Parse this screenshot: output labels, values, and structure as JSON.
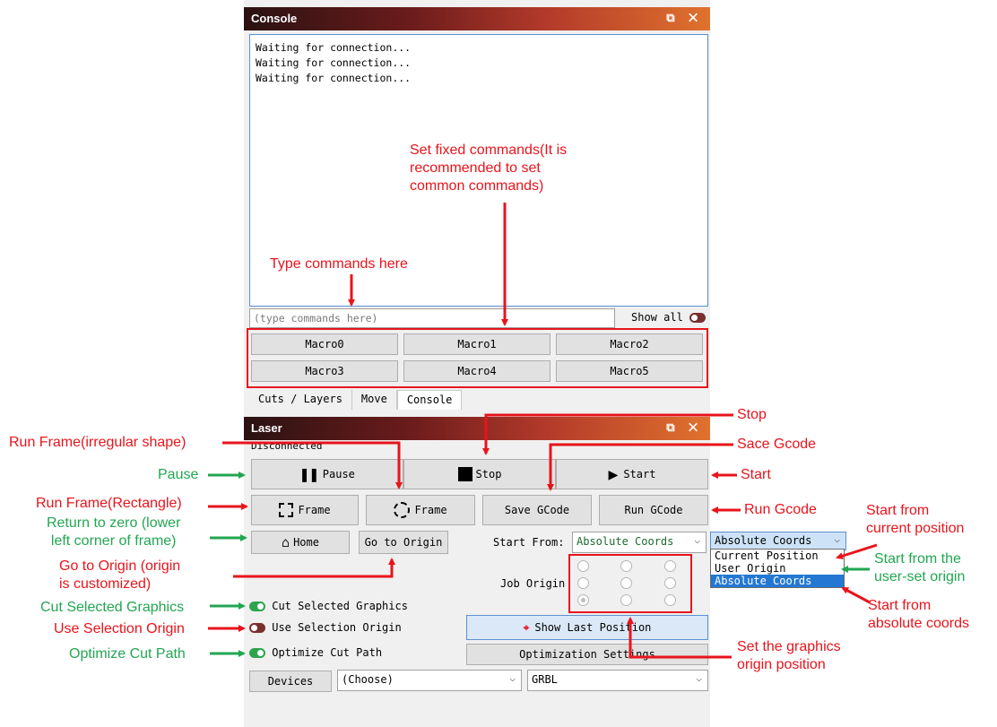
{
  "console": {
    "title": "Console",
    "controls": "⧉ ✕",
    "lines": [
      "Waiting for connection...",
      "Waiting for connection...",
      "Waiting for connection..."
    ],
    "input_placeholder": "(type commands here)",
    "show_all_label": "Show all",
    "macros": [
      "Macro0",
      "Macro1",
      "Macro2",
      "Macro3",
      "Macro4",
      "Macro5"
    ],
    "tabs": [
      "Cuts / Layers",
      "Move",
      "Console"
    ]
  },
  "laser": {
    "title": "Laser",
    "controls": "⧉ ✕",
    "status": "Disconnected",
    "pause": "Pause",
    "stop": "Stop",
    "start": "Start",
    "frame_rect": "Frame",
    "frame_irregular": "Frame",
    "save_gcode": "Save GCode",
    "run_gcode": "Run GCode",
    "home": "Home",
    "go_to_origin": "Go to Origin",
    "start_from_label": "Start From:",
    "start_from_value": "Absolute Coords",
    "start_from_value2": "Absolute Coords",
    "dropdown_options": [
      "Current Position",
      "User Origin",
      "Absolute Coords"
    ],
    "job_origin_label": "Job Origin",
    "cut_selected": "Cut Selected Graphics",
    "use_selection_origin": "Use Selection Origin",
    "optimize_cut_path": "Optimize Cut Path",
    "show_last_position": "Show Last Position",
    "optimization_settings": "Optimization Settings",
    "devices": "Devices",
    "device_choose": "(Choose)",
    "controller": "GRBL"
  },
  "annotations": {
    "fixed_commands": [
      "Set fixed commands(It is",
      "recommended to set",
      "common commands)"
    ],
    "type_commands": "Type commands here",
    "stop": "Stop",
    "run_frame_irregular": "Run Frame(irregular shape)",
    "save_gcode": "Sace Gcode",
    "pause": "Pause",
    "start": "Start",
    "run_frame_rect": "Run Frame(Rectangle)",
    "run_gcode": "Run Gcode",
    "return_zero": [
      "Return to zero (lower",
      "left corner of frame)"
    ],
    "go_origin": [
      "Go to Origin (origin",
      "is customized)"
    ],
    "start_current": [
      "Start from",
      "current position"
    ],
    "start_user": [
      "Start from the",
      "user-set origin"
    ],
    "start_absolute": [
      "Start from",
      "absolute coords"
    ],
    "cut_selected": "Cut Selected Graphics",
    "use_selection_origin": "Use Selection Origin",
    "optimize_cut_path": "Optimize Cut Path",
    "graphics_origin": [
      "Set the graphics",
      "origin position"
    ]
  },
  "colors": {
    "annotation_red": "#e8141c",
    "annotation_green": "#22a652",
    "highlight_blue": "#2478d4"
  }
}
